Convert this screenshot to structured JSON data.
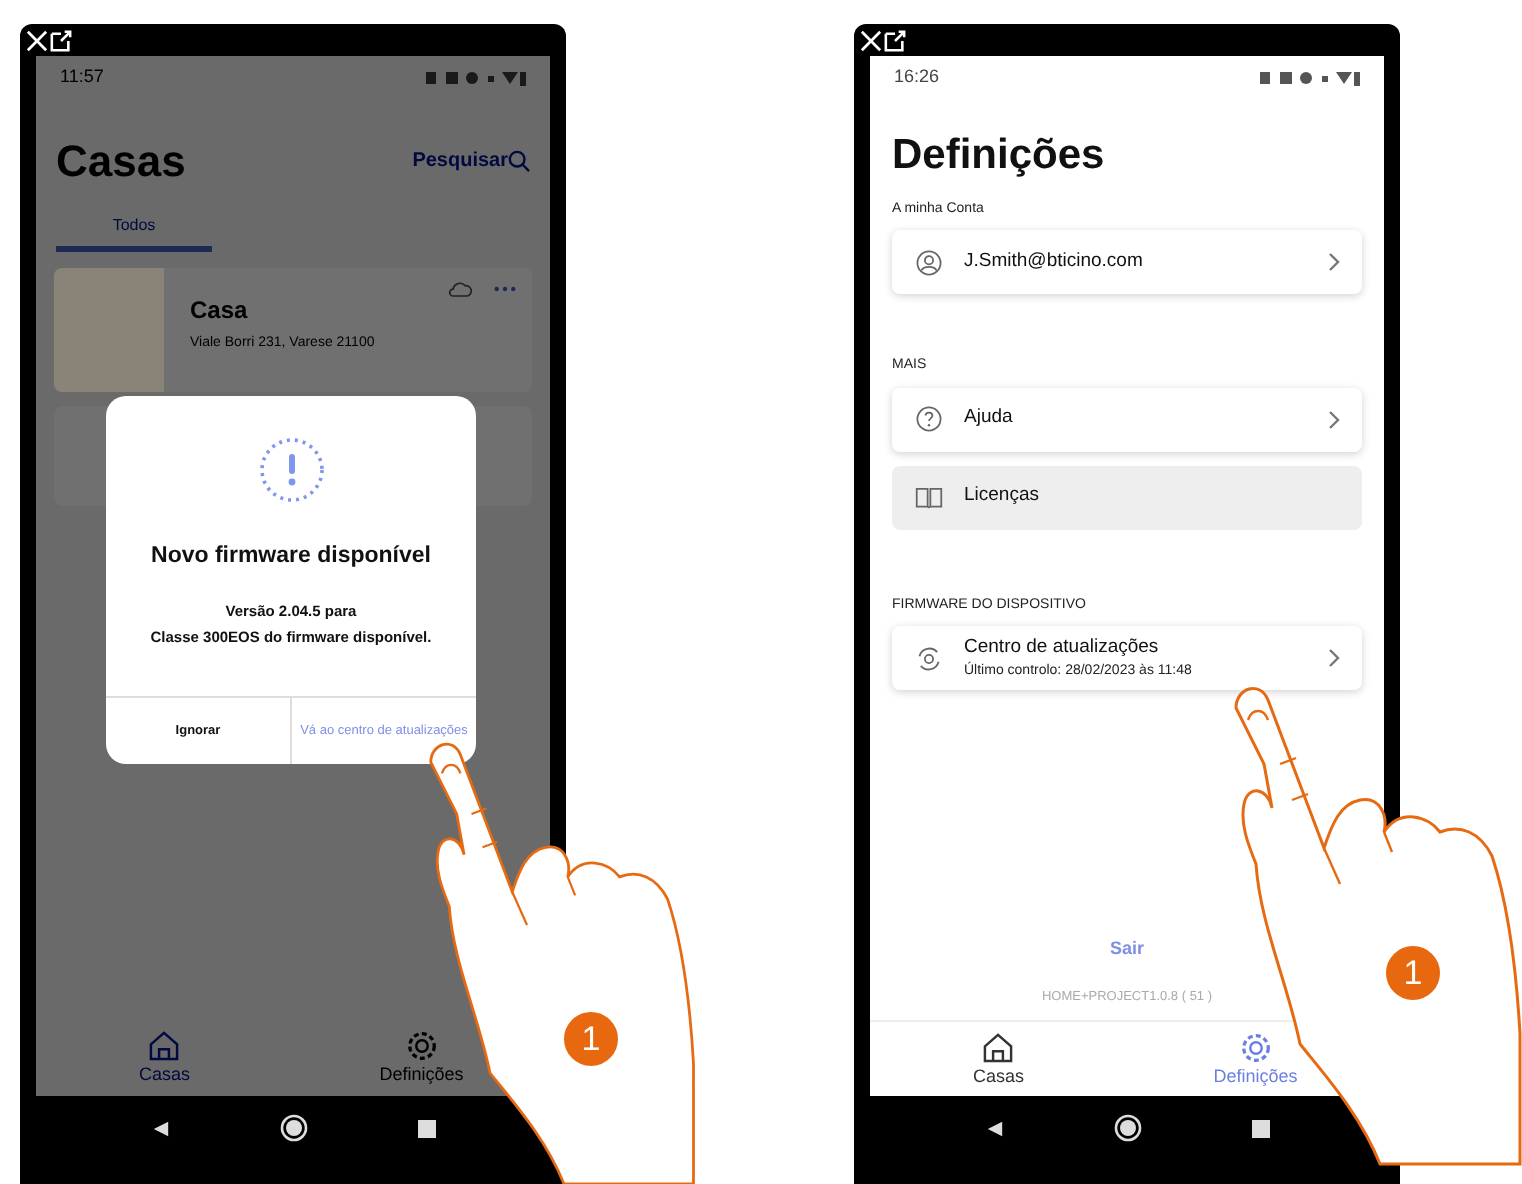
{
  "left_screen": {
    "time": "11:57",
    "title": "Casas",
    "search_label": "Pesquisar",
    "tabs": [
      {
        "label": "Todos",
        "selected": true
      }
    ],
    "homes": [
      {
        "name": "Casa",
        "address": "Viale Borri 231, Varese 21100"
      }
    ],
    "dialog": {
      "title": "Novo firmware disponível",
      "message": "Versão 2.04.5 para\nClasse 300EOS do firmware disponível.",
      "buttons": [
        {
          "label": "Ignorar",
          "kind": "plain"
        },
        {
          "label": "Vá ao centro de atualizações",
          "kind": "link"
        }
      ]
    },
    "nav": [
      {
        "label": "Casas",
        "selected": true
      },
      {
        "label": "Definições",
        "selected": false
      }
    ]
  },
  "right_screen": {
    "time": "16:26",
    "title": "Definições",
    "sections": [
      {
        "heading": "A minha Conta",
        "items": [
          {
            "label": "J.Smith@bticino.com",
            "kind": "card"
          }
        ]
      },
      {
        "heading": "MAIS",
        "items": [
          {
            "label": "Ajuda",
            "kind": "card"
          },
          {
            "label": "Licenças",
            "kind": "flat"
          }
        ]
      },
      {
        "heading": "FIRMWARE DO DISPOSITIVO",
        "items": [
          {
            "label": "Centro de atualizações",
            "sublabel": "Último controlo: 28/02/2023 às 11:48",
            "kind": "card"
          }
        ]
      }
    ],
    "logout": "Sair",
    "version": "HOME+PROJECT1.0.8 ( 51 )",
    "nav": [
      {
        "label": "Casas",
        "selected": false
      },
      {
        "label": "Definições",
        "selected": true
      }
    ]
  },
  "step_badges": [
    "1",
    "1"
  ]
}
